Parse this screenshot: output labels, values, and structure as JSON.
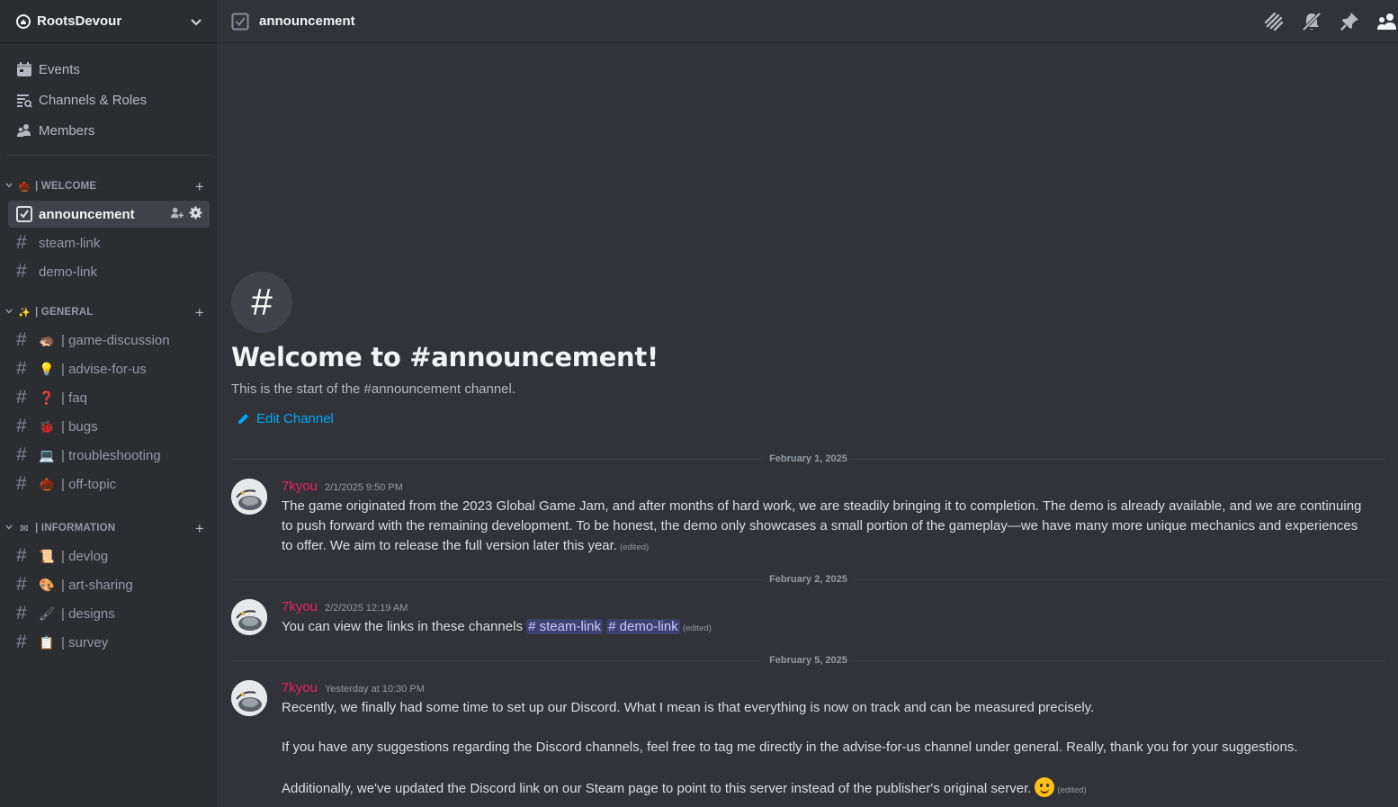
{
  "server": {
    "name": "RootsDevour"
  },
  "menu": [
    {
      "label": "Events",
      "icon": "calendar-icon"
    },
    {
      "label": "Channels & Roles",
      "icon": "channel-browse-icon"
    },
    {
      "label": "Members",
      "icon": "members-icon"
    }
  ],
  "categories": [
    {
      "label": "| WELCOME",
      "emoji": "🌰",
      "channels": [
        {
          "name": "announcement",
          "emoji": "",
          "active": true
        },
        {
          "name": "steam-link",
          "emoji": ""
        },
        {
          "name": "demo-link",
          "emoji": ""
        }
      ]
    },
    {
      "label": "| GENERAL",
      "emoji": "✨",
      "channels": [
        {
          "name": "| game-discussion",
          "emoji": "🦔"
        },
        {
          "name": "| advise-for-us",
          "emoji": "💡"
        },
        {
          "name": "| faq",
          "emoji": "❓"
        },
        {
          "name": "| bugs",
          "emoji": "🐞"
        },
        {
          "name": "| troubleshooting",
          "emoji": "💻"
        },
        {
          "name": "| off-topic",
          "emoji": "🌰"
        }
      ]
    },
    {
      "label": "| INFORMATION",
      "emoji": "✉",
      "channels": [
        {
          "name": "| devlog",
          "emoji": "📜"
        },
        {
          "name": "| art-sharing",
          "emoji": "🎨"
        },
        {
          "name": "| designs",
          "emoji": "🖌"
        },
        {
          "name": "| survey",
          "emoji": "📋"
        }
      ]
    }
  ],
  "topbar": {
    "channel": "announcement"
  },
  "welcome": {
    "glyph": "#",
    "title": "Welcome to #announcement!",
    "subtitle": "This is the start of the #announcement channel.",
    "edit_label": "Edit Channel"
  },
  "dividers": [
    "February 1, 2025",
    "February 2, 2025",
    "February 5, 2025"
  ],
  "messages": [
    {
      "author": "7kyou",
      "timestamp": "2/1/2025 9:50 PM",
      "text": "The game originated from the 2023 Global Game Jam, and after months of hard work, we are steadily bringing it to completion. The demo is already available, and we are continuing to push forward with the remaining development. To be honest, the demo only showcases a small portion of the gameplay—we have many more unique mechanics and experiences to offer. We aim to release the full version later this year.",
      "edited": "(edited)"
    },
    {
      "author": "7kyou",
      "timestamp": "2/2/2025 12:19 AM",
      "text": "You can view the links in these channels",
      "mentions": [
        "# steam-link",
        "# demo-link"
      ],
      "edited": "(edited)"
    },
    {
      "author": "7kyou",
      "timestamp": "Yesterday at 10:30 PM",
      "paragraphs": [
        "Recently, we finally had some time to set up our Discord. What I mean is that everything is now on track and can be measured precisely.",
        "If you have any suggestions regarding the Discord channels, feel free to tag me directly in the advise-for-us channel under general. Really, thank you for your suggestions.",
        "Additionally, we've updated the Discord link on our Steam page to point to this server instead of the publisher's original server."
      ],
      "emoji": "slightly-smiling-face",
      "edited": "(edited)"
    }
  ],
  "colors": {
    "accent_link": "#00a8fc",
    "author": "#e7245a",
    "mention_bg": "#3c4270"
  }
}
